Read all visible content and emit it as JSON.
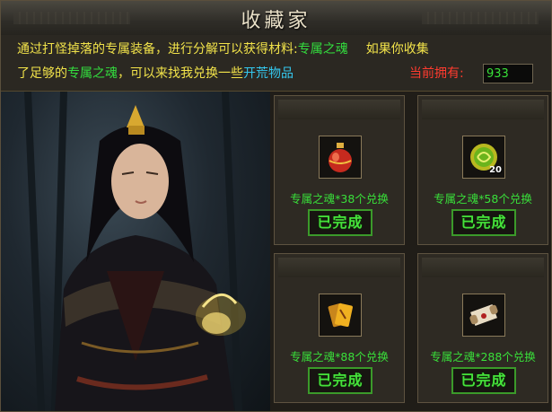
{
  "window": {
    "title": "收藏家"
  },
  "info": {
    "line1_a": "通过打怪掉落的专属装备，进行分解可以获得材料:",
    "line1_b": "专属之魂",
    "line1_c": "如果你收集",
    "line2_a": "了足够的",
    "line2_b": "专属之魂",
    "line2_c": "，可以来找我兑换一些",
    "line2_d": "开荒物品",
    "owned_label": "当前拥有:",
    "owned_value": "933"
  },
  "cards": [
    {
      "icon": "potion-bottle-icon",
      "cost": "专属之魂*38个兑换",
      "button": "已完成",
      "badge": ""
    },
    {
      "icon": "green-rune-icon",
      "cost": "专属之魂*58个兑换",
      "button": "已完成",
      "badge": "20"
    },
    {
      "icon": "gold-cards-icon",
      "cost": "专属之魂*88个兑换",
      "button": "已完成",
      "badge": ""
    },
    {
      "icon": "scroll-icon",
      "cost": "专属之魂*288个兑换",
      "button": "已完成",
      "badge": ""
    }
  ],
  "colors": {
    "yellow": "#f2e34a",
    "green": "#33dd3e",
    "cyan": "#34c8ef",
    "red": "#ff3b2f"
  }
}
